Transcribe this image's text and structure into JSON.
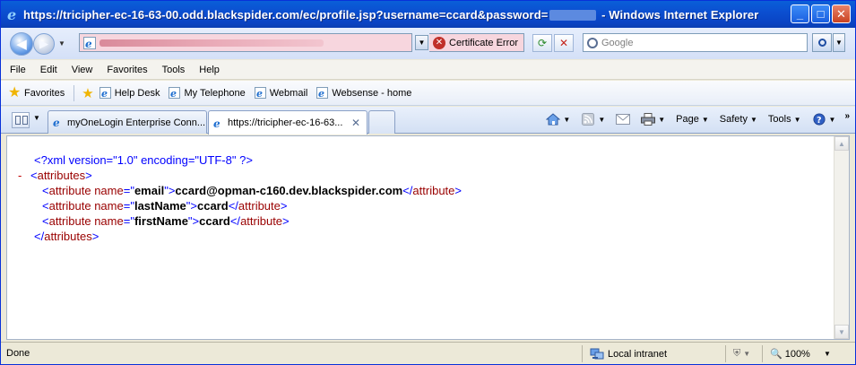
{
  "window": {
    "title_prefix": "https://tricipher-ec-16-63-00.odd.blackspider.com/ec/profile.jsp?username=ccard&password=",
    "title_suffix": " - Windows Internet Explorer"
  },
  "address_bar": {
    "cert_error_label": "Certificate Error",
    "search_placeholder": "Google"
  },
  "menu": [
    "File",
    "Edit",
    "View",
    "Favorites",
    "Tools",
    "Help"
  ],
  "favorites_bar": {
    "label": "Favorites",
    "links": [
      "Help Desk",
      "My Telephone",
      "Webmail",
      "Websense - home"
    ]
  },
  "tabs": [
    {
      "label": "myOneLogin Enterprise Conn...",
      "active": false
    },
    {
      "label": "https://tricipher-ec-16-63...",
      "active": true
    }
  ],
  "command_bar": {
    "page": "Page",
    "safety": "Safety",
    "tools": "Tools"
  },
  "xml": {
    "declaration": "<?xml version=\"1.0\" encoding=\"UTF-8\" ?>",
    "root_tag": "attributes",
    "collapse_symbol": "-",
    "child_tag": "attribute",
    "attr_key": "name",
    "attributes": [
      {
        "name": "email",
        "value": "ccard@opman-c160.dev.blackspider.com"
      },
      {
        "name": "lastName",
        "value": "ccard"
      },
      {
        "name": "firstName",
        "value": "ccard"
      }
    ]
  },
  "status_bar": {
    "status": "Done",
    "zone": "Local intranet",
    "zoom": "100%"
  }
}
